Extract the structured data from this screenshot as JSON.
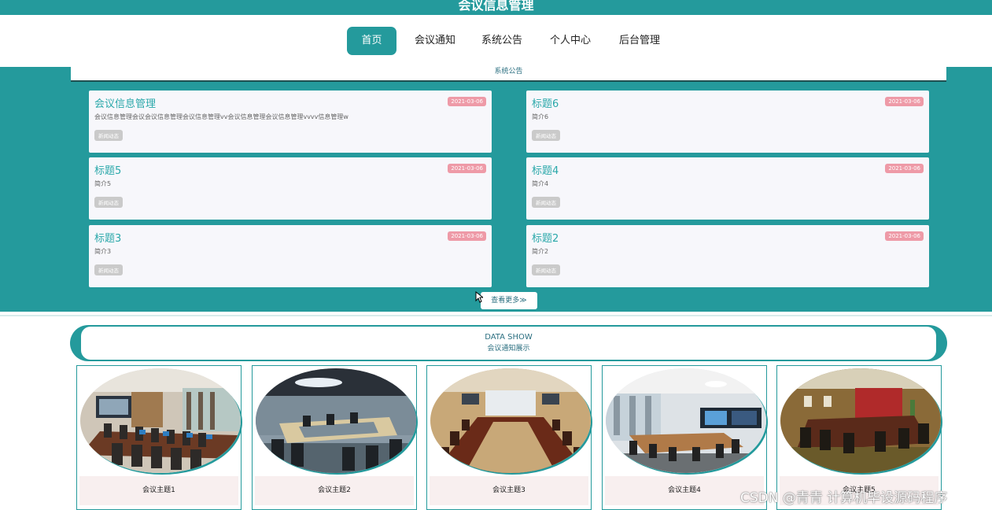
{
  "header": {
    "site_title": "会议信息管理"
  },
  "nav": {
    "items": [
      {
        "label": "首页",
        "active": true
      },
      {
        "label": "会议通知",
        "active": false
      },
      {
        "label": "系统公告",
        "active": false
      },
      {
        "label": "个人中心",
        "active": false
      },
      {
        "label": "后台管理",
        "active": false
      }
    ]
  },
  "notice": {
    "header": "系统公告",
    "cards": [
      {
        "title": "会议信息管理",
        "date": "2021-03-06",
        "desc": "会议信息管理会议会议信息管理会议信息管理vv会议信息管理会议信息管理vvvv信息管理w",
        "tag": "新闻动态"
      },
      {
        "title": "标题6",
        "date": "2021-03-06",
        "desc": "简介6",
        "tag": "新闻动态"
      },
      {
        "title": "标题5",
        "date": "2021-03-06",
        "desc": "简介5",
        "tag": "新闻动态"
      },
      {
        "title": "标题4",
        "date": "2021-03-06",
        "desc": "简介4",
        "tag": "新闻动态"
      },
      {
        "title": "标题3",
        "date": "2021-03-06",
        "desc": "简介3",
        "tag": "新闻动态"
      },
      {
        "title": "标题2",
        "date": "2021-03-06",
        "desc": "简介2",
        "tag": "新闻动态"
      }
    ],
    "more_label": "查看更多≫"
  },
  "data_show": {
    "title_en": "DATA SHOW",
    "title_cn": "会议通知展示",
    "items": [
      {
        "caption": "会议主题1"
      },
      {
        "caption": "会议主题2"
      },
      {
        "caption": "会议主题3"
      },
      {
        "caption": "会议主题4"
      },
      {
        "caption": "会议主题5"
      }
    ]
  },
  "watermark": "CSDN @青青  计算机毕设源码程序",
  "colors": {
    "primary": "#249a9c",
    "date_badge": "#ee9aa7",
    "tag": "#cacaca",
    "caption_bg": "#f8efef"
  }
}
